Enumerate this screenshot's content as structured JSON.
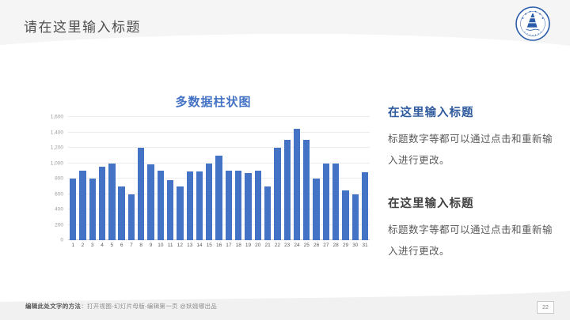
{
  "slide": {
    "title": "请在这里输入标题",
    "page_number": "22",
    "footer": {
      "bold": "编辑此处文字的方法",
      "rest": "：打开视图-幻灯片母版-编辑第一页 @妖娆哪出品"
    },
    "logo": "university-seal"
  },
  "right_panel": {
    "sections": [
      {
        "heading": "在这里输入标题",
        "heading_color": "#2F5B9E",
        "body": "标题数字等都可以通过点击和重新输入进行更改。"
      },
      {
        "heading": "在这里输入标题",
        "heading_color": "#404040",
        "body": "标题数字等都可以通过点击和重新输入进行更改。"
      }
    ]
  },
  "chart_data": {
    "type": "bar",
    "title": "多数据柱状图",
    "title_color": "#4472C4",
    "bar_color": "#4472C4",
    "categories": [
      "1",
      "2",
      "3",
      "4",
      "5",
      "6",
      "7",
      "8",
      "9",
      "10",
      "11",
      "12",
      "13",
      "14",
      "15",
      "16",
      "17",
      "18",
      "19",
      "20",
      "21",
      "22",
      "23",
      "24",
      "25",
      "26",
      "27",
      "28",
      "29",
      "30",
      "31"
    ],
    "values": [
      800,
      900,
      800,
      950,
      1000,
      700,
      600,
      1200,
      980,
      900,
      780,
      700,
      890,
      890,
      1000,
      1100,
      900,
      900,
      870,
      900,
      700,
      1200,
      1300,
      1450,
      1300,
      800,
      1000,
      1000,
      650,
      600,
      880
    ],
    "xlabel": "",
    "ylabel": "",
    "ylim": [
      0,
      1600
    ],
    "y_tick_values": [
      0,
      200,
      400,
      600,
      800,
      1000,
      1200,
      1400,
      1600
    ],
    "y_tick_labels": [
      "0",
      "200",
      "400",
      "600",
      "800",
      "1,000",
      "1,200",
      "1,400",
      "1,600"
    ],
    "grid": true,
    "legend_position": "none"
  },
  "colors": {
    "accent_blue": "#4472C4",
    "heading_blue": "#2F5B9E",
    "band_gray_top": "#f5f5f5",
    "band_gray_bottom": "#f1f1f2",
    "logo_blue": "#2a5caa"
  }
}
